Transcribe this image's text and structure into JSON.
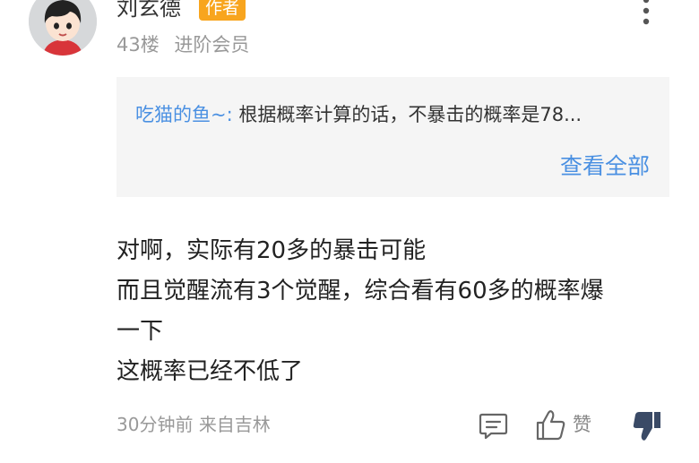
{
  "header": {
    "username": "刘玄德",
    "badge": "作者",
    "floor": "43楼",
    "member_level": "进阶会员"
  },
  "quote": {
    "author": "吃猫的鱼~:",
    "text": " 根据概率计算的话，不暴击的概率是78...",
    "view_all": "查看全部"
  },
  "comment": {
    "lines": [
      "对啊，实际有20多的暴击可能",
      "而且觉醒流有3个觉醒，综合看有60多的概率爆",
      "一下",
      "这概率已经不低了"
    ]
  },
  "footer": {
    "time": "30分钟前",
    "location": "来自吉林",
    "like_label": "赞"
  },
  "colors": {
    "accent": "#4a90e2",
    "badge": "#f8a51e",
    "muted": "#999999",
    "dislike_active": "#3a4a66"
  },
  "icons": {
    "more": "more-vertical-icon",
    "comment": "comment-icon",
    "like": "thumbs-up-icon",
    "dislike": "thumbs-down-icon"
  }
}
